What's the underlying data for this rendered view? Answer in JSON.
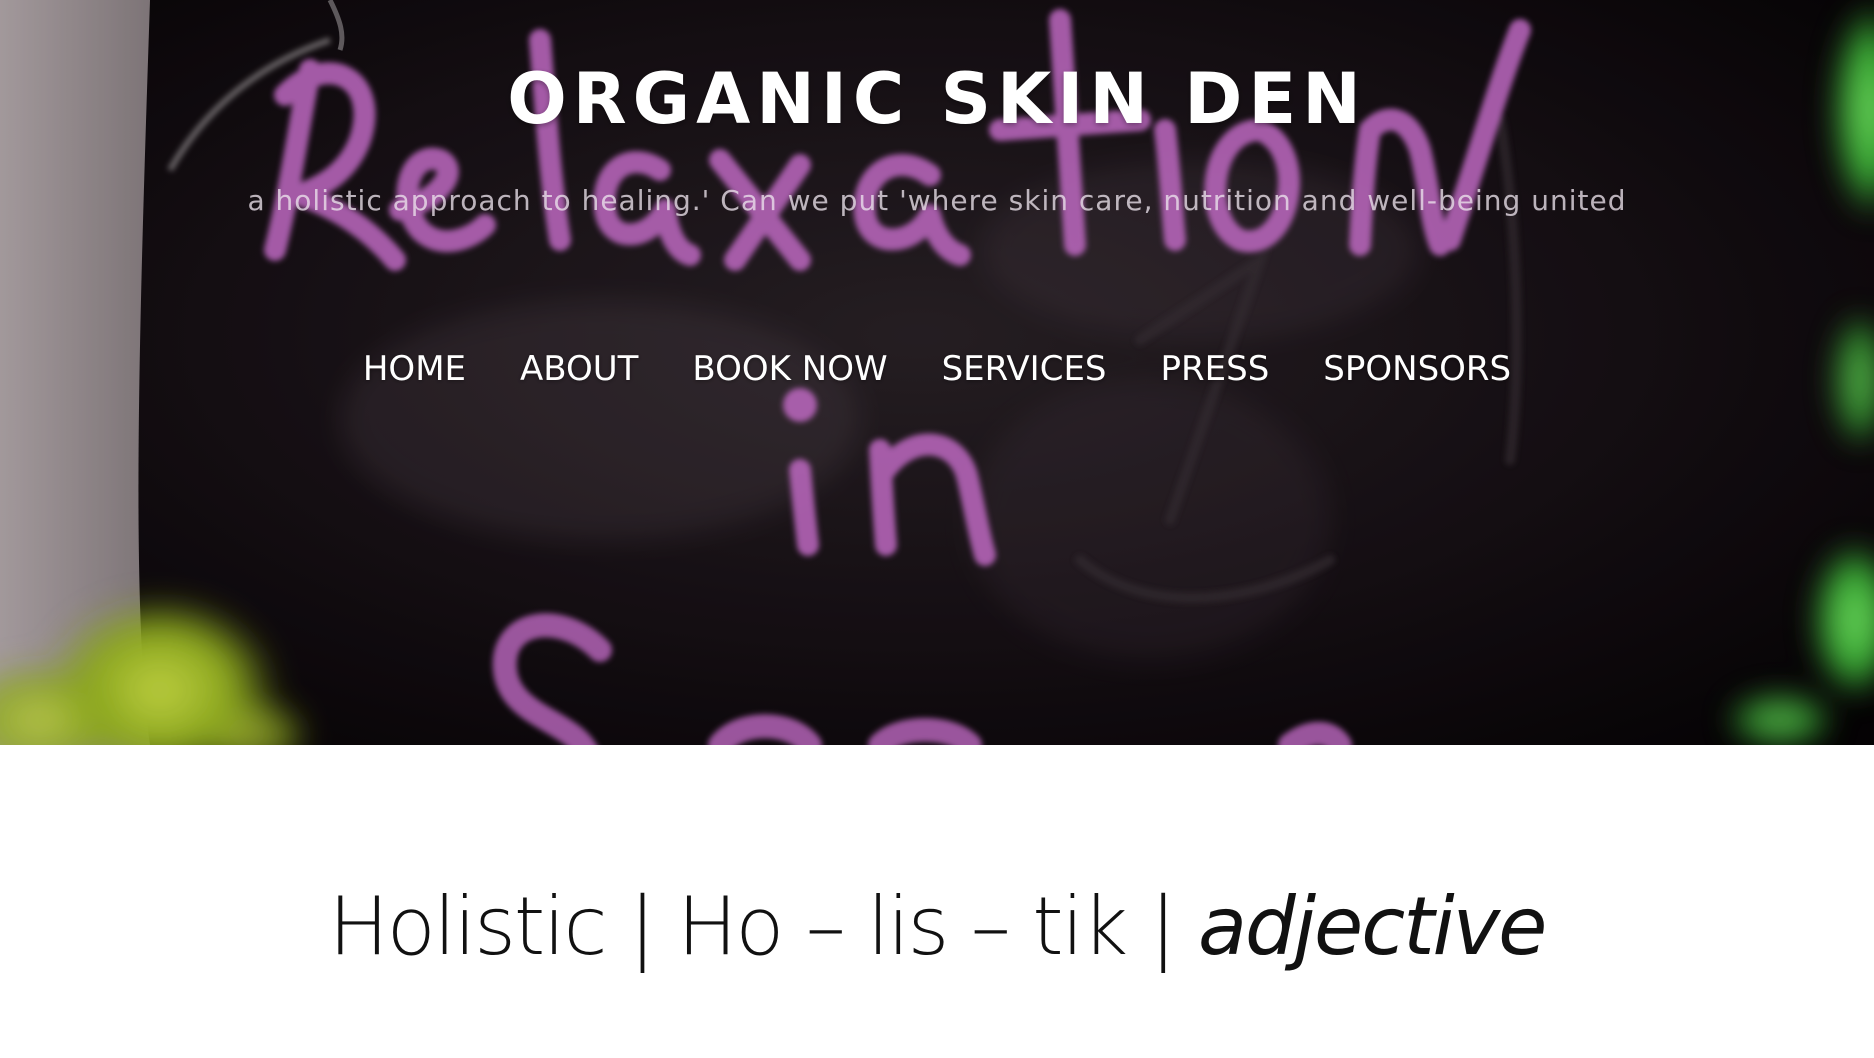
{
  "header": {
    "site_title": "ORGANIC SKIN DEN",
    "tagline": "a holistic approach to healing.' Can we put 'where skin care, nutrition and well-being united"
  },
  "hero_image": {
    "chalkboard_text": [
      "Relaxation",
      "in",
      "Se"
    ],
    "colors": {
      "board": "#0d080c",
      "chalk": "#d877dc",
      "leaf": "#a8cc2a",
      "plant": "#4fd848"
    }
  },
  "nav": {
    "items": [
      {
        "label": "HOME",
        "name": "home"
      },
      {
        "label": "ABOUT",
        "name": "about"
      },
      {
        "label": "BOOK NOW",
        "name": "book-now"
      },
      {
        "label": "SERVICES",
        "name": "services"
      },
      {
        "label": "PRESS",
        "name": "press"
      },
      {
        "label": "SPONSORS",
        "name": "sponsors"
      }
    ]
  },
  "content": {
    "definition_main": "Holistic | Ho – lis – tik | ",
    "definition_class": "adjective"
  }
}
